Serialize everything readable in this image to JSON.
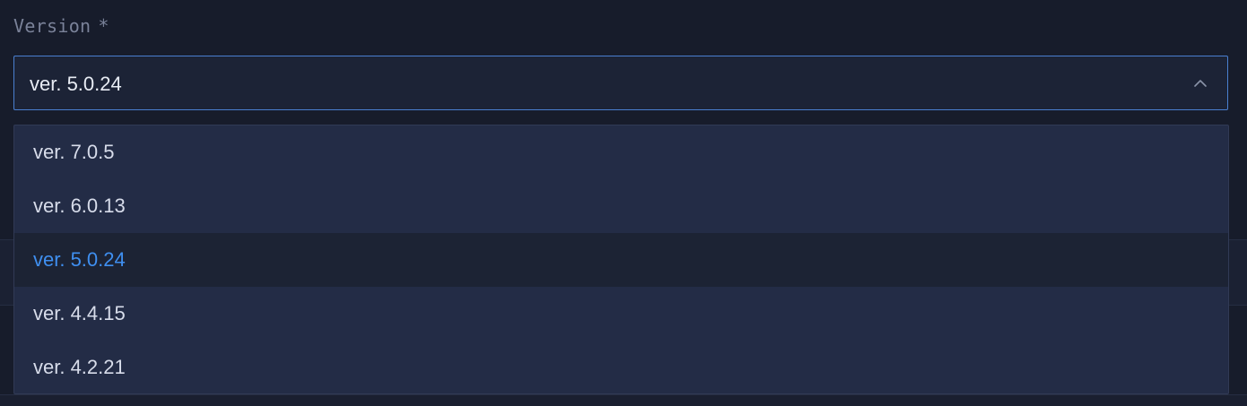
{
  "field": {
    "label": "Version",
    "required_mark": "*"
  },
  "select": {
    "value": "ver. 5.0.24",
    "expanded": true,
    "chevron_icon": "chevron-up-icon"
  },
  "dropdown": {
    "options": [
      {
        "label": "ver. 7.0.5",
        "selected": false
      },
      {
        "label": "ver. 6.0.13",
        "selected": false
      },
      {
        "label": "ver. 5.0.24",
        "selected": true
      },
      {
        "label": "ver. 4.4.15",
        "selected": false
      },
      {
        "label": "ver. 4.2.21",
        "selected": false
      }
    ]
  },
  "colors": {
    "background": "#171c2b",
    "select_border": "#4a7fd0",
    "dropdown_bg": "#232c46",
    "selected_text": "#3f8ff0"
  }
}
